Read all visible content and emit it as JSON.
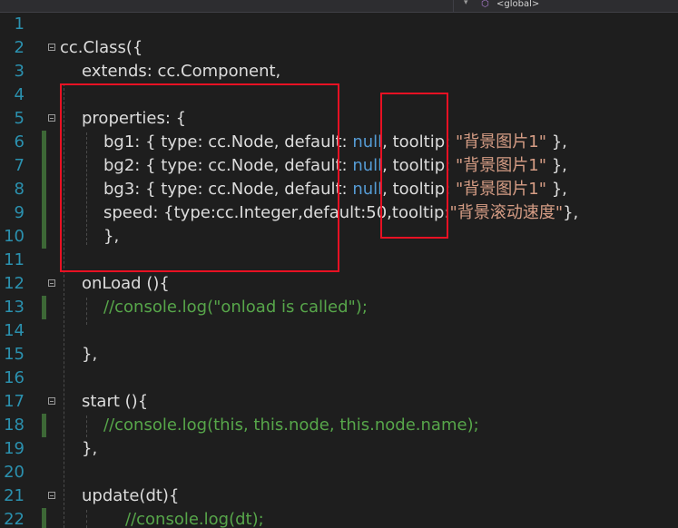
{
  "toolbar": {
    "dropdown_arrow": "▾",
    "scope_label": "<global>"
  },
  "line_numbers": [
    "1",
    "2",
    "3",
    "4",
    "5",
    "6",
    "7",
    "8",
    "9",
    "10",
    "11",
    "12",
    "13",
    "14",
    "15",
    "16",
    "17",
    "18",
    "19",
    "20",
    "21",
    "22"
  ],
  "code": {
    "l2": "cc.Class({",
    "l3": "extends: cc.Component,",
    "l5": "properties: {",
    "l6a": "bg1: { type: cc.Node, default: ",
    "l7a": "bg2: { type: cc.Node, default: ",
    "l8a": "bg3: { type: cc.Node, default: ",
    "null_kw": "null",
    "tooltip_part": ", tooltip: ",
    "tooltip_str": "\"背景图片1\"",
    "close_part": " },",
    "l9a": "speed: {type:cc.Integer,default:50,tooltip:",
    "l9str": "\"背景滚动速度\"",
    "l9b": "},",
    "l10": "},",
    "l12": "onLoad (){",
    "l13": "//console.log(\"onload is called\");",
    "l15": "},",
    "l17": "start (){",
    "l18": "//console.log(this, this.node, this.node.name);",
    "l19": "},",
    "l21": "update(dt){",
    "l22": "//console.log(dt);"
  },
  "colors": {
    "background": "#1e1e1e",
    "line_number": "#2b91af",
    "keyword": "#569cd6",
    "string": "#d69d85",
    "comment": "#57a64a",
    "annotation_box": "#e81123"
  }
}
